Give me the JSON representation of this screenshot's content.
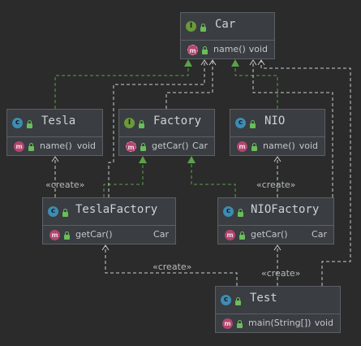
{
  "colors": {
    "background": "#2b2b2b",
    "box": "#3a3d41",
    "border": "#5c6066",
    "realization": "#5aa24a",
    "dependency": "#c9ccd0",
    "interface_badge": "#6a9a3a",
    "class_badge": "#3d8cb3",
    "method_badge": "#b3456e"
  },
  "nodes": {
    "car": {
      "kind": "interface",
      "name": "Car",
      "member": "name()",
      "type": "void"
    },
    "tesla": {
      "kind": "class",
      "name": "Tesla",
      "member": "name()",
      "type": "void"
    },
    "factory": {
      "kind": "interface",
      "name": "Factory",
      "member": "getCar()",
      "type": "Car"
    },
    "nio": {
      "kind": "class",
      "name": "NIO",
      "member": "name()",
      "type": "void"
    },
    "tesla_factory": {
      "kind": "class",
      "name": "TeslaFactory",
      "member": "getCar()",
      "type": "Car"
    },
    "nio_factory": {
      "kind": "class",
      "name": "NIOFactory",
      "member": "getCar()",
      "type": "Car"
    },
    "test": {
      "kind": "class",
      "name": "Test",
      "member": "main(String[])",
      "type": "void"
    }
  },
  "badges": {
    "interface": "I",
    "class": "c",
    "method": "m"
  },
  "edge_labels": {
    "tesla_create": "«create»",
    "nio_create": "«create»",
    "test_tesla_factory_create": "«create»",
    "test_nio_factory_create": "«create»"
  }
}
